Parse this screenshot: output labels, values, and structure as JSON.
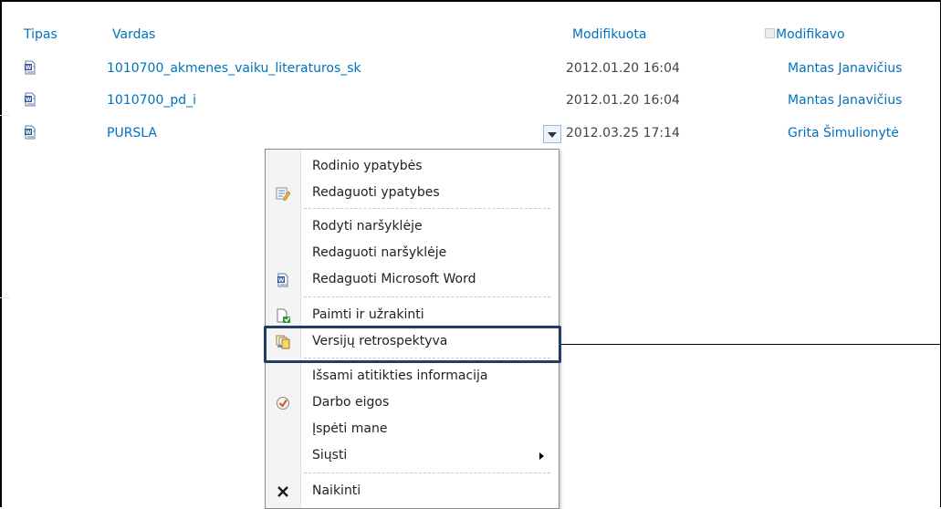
{
  "header": {
    "col_type": "Tipas",
    "col_name": "Vardas",
    "col_modified": "Modifikuota",
    "col_modified_by": "Modifikavo"
  },
  "rows": [
    {
      "name": "1010700_akmenes_vaiku_literaturos_sk",
      "modified": "2012.01.20 16:04",
      "modified_by": "Mantas Janavičius"
    },
    {
      "name": "1010700_pd_i",
      "modified": "2012.01.20 16:04",
      "modified_by": "Mantas Janavičius"
    },
    {
      "name": "PURSLA",
      "modified": "2012.03.25 17:14",
      "modified_by": "Grita Šimulionytė"
    }
  ],
  "context_menu": {
    "items": [
      {
        "label": "Rodinio ypatybės",
        "icon": ""
      },
      {
        "label": "Redaguoti ypatybes",
        "icon": "edit-properties-icon"
      },
      {
        "label": "Rodyti naršyklėje",
        "icon": ""
      },
      {
        "label": "Redaguoti naršyklėje",
        "icon": ""
      },
      {
        "label": "Redaguoti Microsoft Word",
        "icon": "word-document-icon"
      },
      {
        "label": "Paimti ir užrakinti",
        "icon": "check-out-icon"
      },
      {
        "label": "Versijų retrospektyva",
        "icon": "version-history-icon"
      },
      {
        "label": "Išsami atitikties informacija",
        "icon": ""
      },
      {
        "label": "Darbo eigos",
        "icon": "workflow-icon"
      },
      {
        "label": "Įspėti mane",
        "icon": ""
      },
      {
        "label": "Siųsti",
        "icon": "",
        "submenu": true
      },
      {
        "label": "Naikinti",
        "icon": "delete-icon"
      }
    ]
  },
  "colors": {
    "link": "#0072bc",
    "highlight_border": "#1f3f66"
  }
}
